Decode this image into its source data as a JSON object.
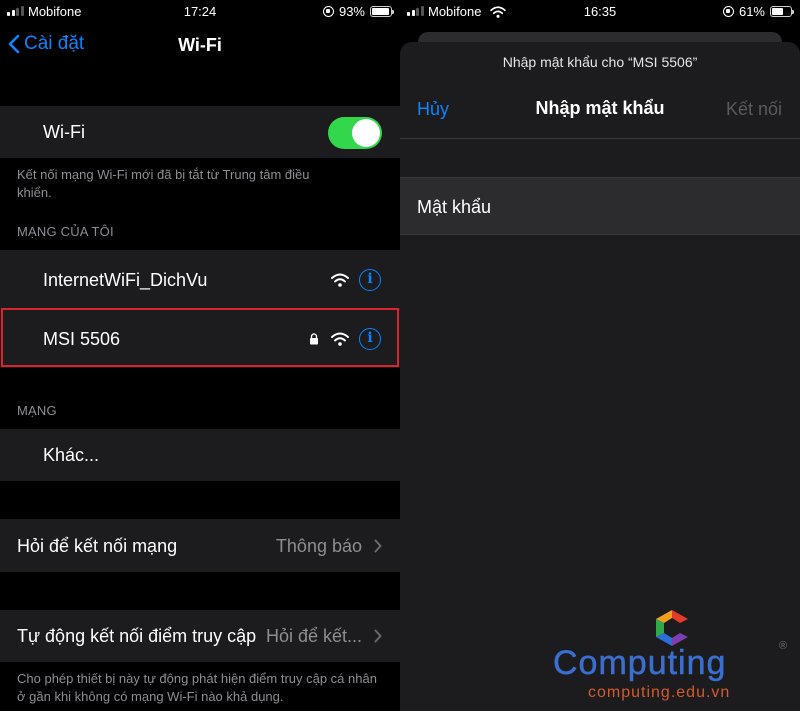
{
  "left_screen": {
    "status": {
      "carrier": "Mobifone",
      "time": "17:24",
      "battery": "93%"
    },
    "nav": {
      "back_label": "Cài đặt",
      "title": "Wi-Fi"
    },
    "wifi_toggle": {
      "label": "Wi-Fi",
      "on": true
    },
    "wifi_note": "Kết nối mạng Wi-Fi mới đã bị tắt từ Trung tâm điều khiển.",
    "my_networks_header": "MẠNG CỦA TÔI",
    "my_networks": [
      {
        "name": "InternetWiFi_DichVu",
        "locked": false
      },
      {
        "name": "MSI 5506",
        "locked": true
      }
    ],
    "networks_header": "MẠNG",
    "other_label": "Khác...",
    "ask_join": {
      "label": "Hỏi để kết nối mạng",
      "value": "Thông báo"
    },
    "auto_join": {
      "label": "Tự động kết nối điểm truy cập",
      "value": "Hỏi để kết..."
    },
    "auto_join_note": "Cho phép thiết bị này tự động phát hiện điểm truy cập cá nhân ở gần khi không có mạng Wi-Fi nào khả dụng."
  },
  "right_screen": {
    "status": {
      "carrier": "Mobifone",
      "time": "16:35",
      "battery": "61%"
    },
    "prompt": "Nhập mật khẩu cho “MSI 5506”",
    "cancel_label": "Hủy",
    "title": "Nhập mật khẩu",
    "join_label": "Kết nối",
    "password_label": "Mật khẩu",
    "password_value": ""
  },
  "watermark": {
    "name": "Computing",
    "reg": "®",
    "url": "computing.edu.vn"
  },
  "colors": {
    "accent": "#0a84ff",
    "toggle_on": "#32d74b",
    "highlight": "#d9262c",
    "group_bg": "#1c1c1e"
  }
}
